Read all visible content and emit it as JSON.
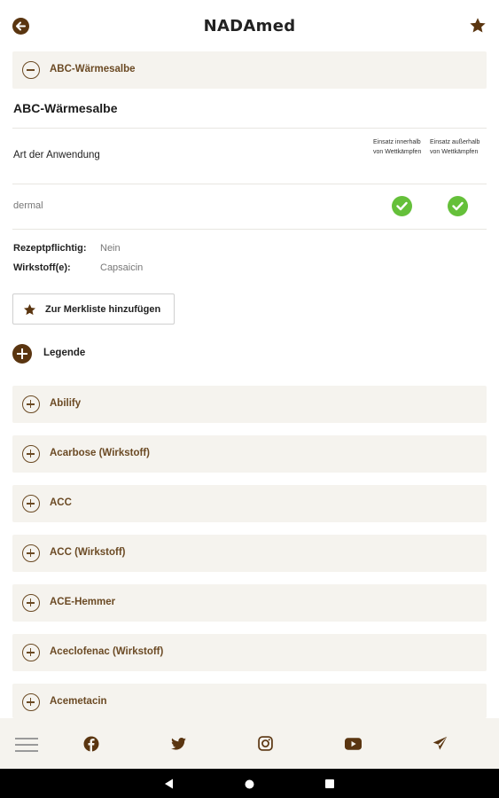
{
  "app": {
    "title": "NADAmed"
  },
  "header": {
    "back_icon": "arrow-left-circle-icon",
    "favorite_icon": "star-icon"
  },
  "expanded_item": {
    "label": "ABC-Wärmesalbe",
    "title": "ABC-Wärmesalbe",
    "art_label": "Art der Anwendung",
    "columns": [
      "Einsatz innerhalb von Wettkämpfen",
      "Einsatz außerhalb von Wettkämpfen"
    ],
    "rows": [
      {
        "name": "dermal",
        "innerhalb": true,
        "ausserhalb": true
      }
    ],
    "rezept_label": "Rezeptpflichtig:",
    "rezept_value": "Nein",
    "wirkstoff_label": "Wirkstoff(e):",
    "wirkstoff_value": "Capsaicin",
    "merkliste_button": "Zur Merkliste hinzufügen"
  },
  "legende": {
    "label": "Legende"
  },
  "list_items": [
    {
      "label": "Abilify"
    },
    {
      "label": "Acarbose (Wirkstoff)"
    },
    {
      "label": "ACC"
    },
    {
      "label": "ACC (Wirkstoff)"
    },
    {
      "label": "ACE-Hemmer"
    },
    {
      "label": "Aceclofenac (Wirkstoff)"
    },
    {
      "label": "Acemetacin"
    }
  ],
  "bottom_nav": [
    "menu-icon",
    "facebook-icon",
    "twitter-icon",
    "instagram-icon",
    "youtube-icon",
    "send-icon"
  ],
  "colors": {
    "brown": "#5a3510",
    "accent_text": "#6b4a24",
    "panel_bg": "#f5f3ee",
    "check_green": "#65c03a"
  }
}
